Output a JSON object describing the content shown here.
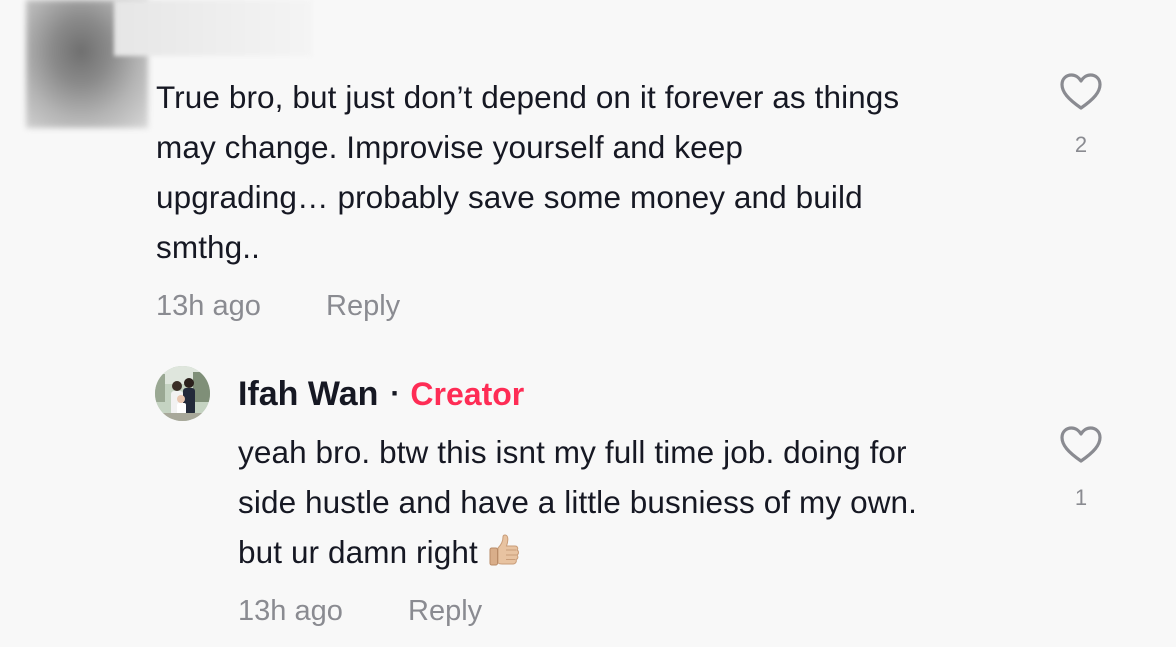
{
  "comments": [
    {
      "author_blurred": true,
      "text": "True bro, but just don’t depend on it forever as things\nmay change. Improvise yourself and keep\nupgrading… probably save some money and build\nsmthg..",
      "time": "13h ago",
      "reply_label": "Reply",
      "like_count": "2",
      "icon": "heart-outline-icon"
    },
    {
      "author": "Ifah Wan",
      "separator": "·",
      "badge": "Creator",
      "text": "yeah bro. btw this isnt my full time job. doing for\nside hustle and have a little busniess of my own.\nbut ur damn right",
      "emoji": "thumbs-up-emoji",
      "time": "13h ago",
      "reply_label": "Reply",
      "like_count": "1",
      "icon": "heart-outline-icon"
    }
  ],
  "colors": {
    "background": "#f8f8f8",
    "text": "#161823",
    "secondary_text": "#8a8b91",
    "creator_badge": "#fe2c55"
  }
}
